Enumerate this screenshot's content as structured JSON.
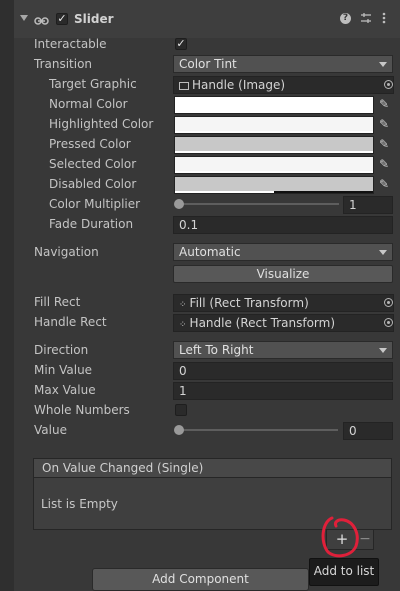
{
  "component": {
    "title": "Slider",
    "enabled": true
  },
  "fields": {
    "interactable": {
      "label": "Interactable",
      "checked": true
    },
    "transition": {
      "label": "Transition",
      "value": "Color Tint"
    },
    "target_graphic": {
      "label": "Target Graphic",
      "value": "Handle (Image)"
    },
    "normal_color": {
      "label": "Normal Color",
      "value": "#ffffff"
    },
    "highlighted_color": {
      "label": "Highlighted Color",
      "value": "#f5f5f5"
    },
    "pressed_color": {
      "label": "Pressed Color",
      "value": "#c8c8c8"
    },
    "selected_color": {
      "label": "Selected Color",
      "value": "#f5f5f5"
    },
    "disabled_color": {
      "label": "Disabled Color",
      "value": "#c8c8c8",
      "alpha": 0.5
    },
    "color_multiplier": {
      "label": "Color Multiplier",
      "value": "1",
      "level": 0.0
    },
    "fade_duration": {
      "label": "Fade Duration",
      "value": "0.1"
    },
    "navigation": {
      "label": "Navigation",
      "value": "Automatic"
    },
    "visualize": {
      "label": "Visualize"
    },
    "fill_rect": {
      "label": "Fill Rect",
      "value": "Fill (Rect Transform)"
    },
    "handle_rect": {
      "label": "Handle Rect",
      "value": "Handle (Rect Transform)"
    },
    "direction": {
      "label": "Direction",
      "value": "Left To Right"
    },
    "min_value": {
      "label": "Min Value",
      "value": "0"
    },
    "max_value": {
      "label": "Max Value",
      "value": "1"
    },
    "whole_numbers": {
      "label": "Whole Numbers",
      "checked": false
    },
    "value": {
      "label": "Value",
      "value": "0",
      "level": 0.0
    }
  },
  "event": {
    "title": "On Value Changed (Single)",
    "empty_text": "List is Empty",
    "add": "+",
    "remove": "−"
  },
  "tooltip": "Add to list",
  "add_component": "Add Component",
  "icons": {
    "foldout": "foldout-arrow-icon",
    "script": "script-icon",
    "help": "help-icon",
    "presets": "presets-icon",
    "menu": "kebab-menu-icon",
    "picker": "object-picker-icon",
    "eyedropper": "eyedropper-icon",
    "annotation_color": "#e0203a"
  }
}
